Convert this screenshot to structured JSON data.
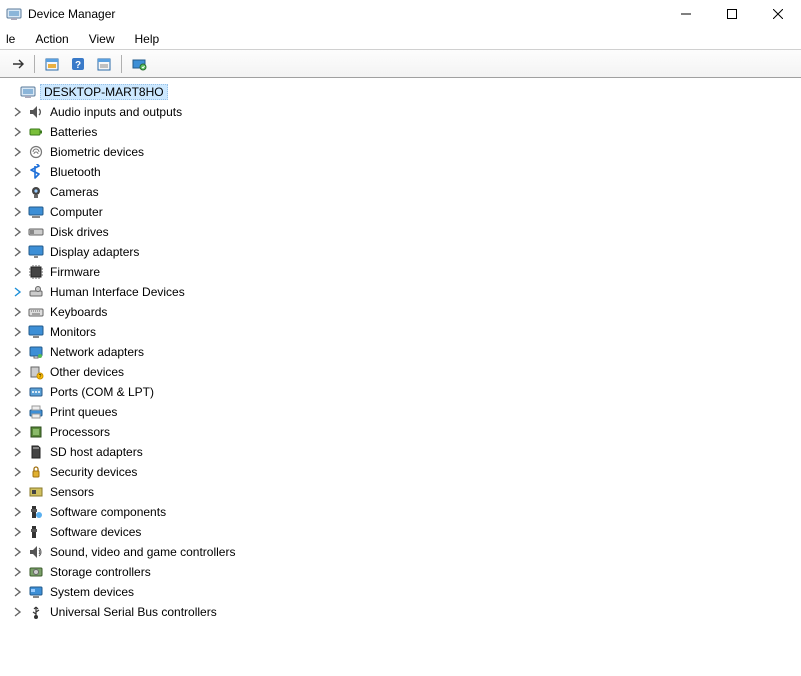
{
  "window": {
    "title": "Device Manager"
  },
  "menu": {
    "items": [
      "le",
      "Action",
      "View",
      "Help"
    ]
  },
  "toolbar": {
    "buttons": [
      "back-forward",
      "show-hidden",
      "help",
      "properties",
      "scan-hardware"
    ]
  },
  "tree": {
    "root": "DESKTOP-MART8HO",
    "categories": [
      {
        "icon": "audio",
        "label": "Audio inputs and outputs"
      },
      {
        "icon": "battery",
        "label": "Batteries"
      },
      {
        "icon": "biometric",
        "label": "Biometric devices"
      },
      {
        "icon": "bluetooth",
        "label": "Bluetooth"
      },
      {
        "icon": "camera",
        "label": "Cameras"
      },
      {
        "icon": "computer",
        "label": "Computer"
      },
      {
        "icon": "diskdrive",
        "label": "Disk drives"
      },
      {
        "icon": "display",
        "label": "Display adapters"
      },
      {
        "icon": "firmware",
        "label": "Firmware"
      },
      {
        "icon": "hid",
        "label": "Human Interface Devices",
        "highlight": true
      },
      {
        "icon": "keyboard",
        "label": "Keyboards"
      },
      {
        "icon": "monitor",
        "label": "Monitors"
      },
      {
        "icon": "network",
        "label": "Network adapters"
      },
      {
        "icon": "other",
        "label": "Other devices"
      },
      {
        "icon": "ports",
        "label": "Ports (COM & LPT)"
      },
      {
        "icon": "printer",
        "label": "Print queues"
      },
      {
        "icon": "processor",
        "label": "Processors"
      },
      {
        "icon": "sdhost",
        "label": "SD host adapters"
      },
      {
        "icon": "security",
        "label": "Security devices"
      },
      {
        "icon": "sensors",
        "label": "Sensors"
      },
      {
        "icon": "swcomp",
        "label": "Software components"
      },
      {
        "icon": "swdev",
        "label": "Software devices"
      },
      {
        "icon": "sound",
        "label": "Sound, video and game controllers"
      },
      {
        "icon": "storage",
        "label": "Storage controllers"
      },
      {
        "icon": "system",
        "label": "System devices"
      },
      {
        "icon": "usb",
        "label": "Universal Serial Bus controllers"
      }
    ]
  }
}
